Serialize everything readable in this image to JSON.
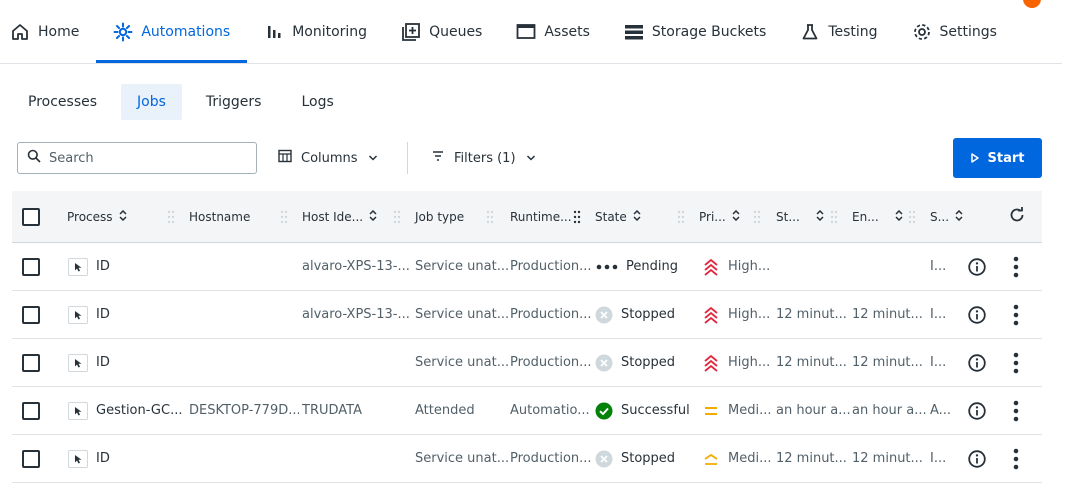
{
  "nav": {
    "items": [
      {
        "label": "Home",
        "icon": "home-icon"
      },
      {
        "label": "Automations",
        "icon": "automations-icon",
        "active": true
      },
      {
        "label": "Monitoring",
        "icon": "monitoring-icon"
      },
      {
        "label": "Queues",
        "icon": "queues-icon"
      },
      {
        "label": "Assets",
        "icon": "assets-icon"
      },
      {
        "label": "Storage Buckets",
        "icon": "storage-buckets-icon"
      },
      {
        "label": "Testing",
        "icon": "testing-icon"
      },
      {
        "label": "Settings",
        "icon": "gear-icon"
      }
    ]
  },
  "subtabs": [
    {
      "label": "Processes"
    },
    {
      "label": "Jobs",
      "active": true
    },
    {
      "label": "Triggers"
    },
    {
      "label": "Logs"
    }
  ],
  "toolbar": {
    "search_placeholder": "Search",
    "columns_label": "Columns",
    "filters_label": "Filters (1)",
    "start_label": "Start"
  },
  "grid": {
    "columns": {
      "process": "Process",
      "hostname": "Hostname",
      "host_identity": "Host Ide...",
      "job_type": "Job type",
      "runtime": "Runtime...",
      "state": "State",
      "priority": "Pri...",
      "started": "St...",
      "ended": "En...",
      "source": "S..."
    },
    "rows": [
      {
        "process": "ID",
        "hostname": "",
        "host_identity": "alvaro-XPS-13-...",
        "job_type": "Service unat...",
        "runtime": "Production...",
        "state": "Pending",
        "state_icon": "pending-dots-icon",
        "priority": "High...",
        "priority_icon": "priority-high-icon",
        "started": "",
        "ended": "",
        "source": "I..."
      },
      {
        "process": "ID",
        "hostname": "",
        "host_identity": "alvaro-XPS-13-...",
        "job_type": "Service unat...",
        "runtime": "Production...",
        "state": "Stopped",
        "state_icon": "stopped-icon",
        "priority": "High...",
        "priority_icon": "priority-high-icon",
        "started": "12 minut...",
        "ended": "12 minut...",
        "source": "I..."
      },
      {
        "process": "ID",
        "hostname": "",
        "host_identity": "",
        "job_type": "Service unat...",
        "runtime": "Production...",
        "state": "Stopped",
        "state_icon": "stopped-icon",
        "priority": "High...",
        "priority_icon": "priority-high-icon",
        "started": "12 minut...",
        "ended": "12 minut...",
        "source": "I..."
      },
      {
        "process": "Gestion-GC...",
        "hostname": "DESKTOP-779D...",
        "host_identity": "TRUDATA",
        "job_type": "Attended",
        "runtime": "Automatio...",
        "state": "Successful",
        "state_icon": "success-check-icon",
        "priority": "Medi...",
        "priority_icon": "priority-medium-icon",
        "started": "an hour a...",
        "ended": "an hour a...",
        "source": "A..."
      },
      {
        "process": "ID",
        "hostname": "",
        "host_identity": "",
        "job_type": "Service unat...",
        "runtime": "Production...",
        "state": "Stopped",
        "state_icon": "stopped-icon",
        "priority": "Medi...",
        "priority_icon": "priority-medium-high-icon",
        "started": "12 minut...",
        "ended": "12 minut...",
        "source": "I..."
      }
    ]
  },
  "colors": {
    "accent": "#0067df",
    "priority_high": "#e0263d",
    "priority_medium": "#f4ab00",
    "success": "#038108",
    "stopped": "#a4b1b8"
  }
}
